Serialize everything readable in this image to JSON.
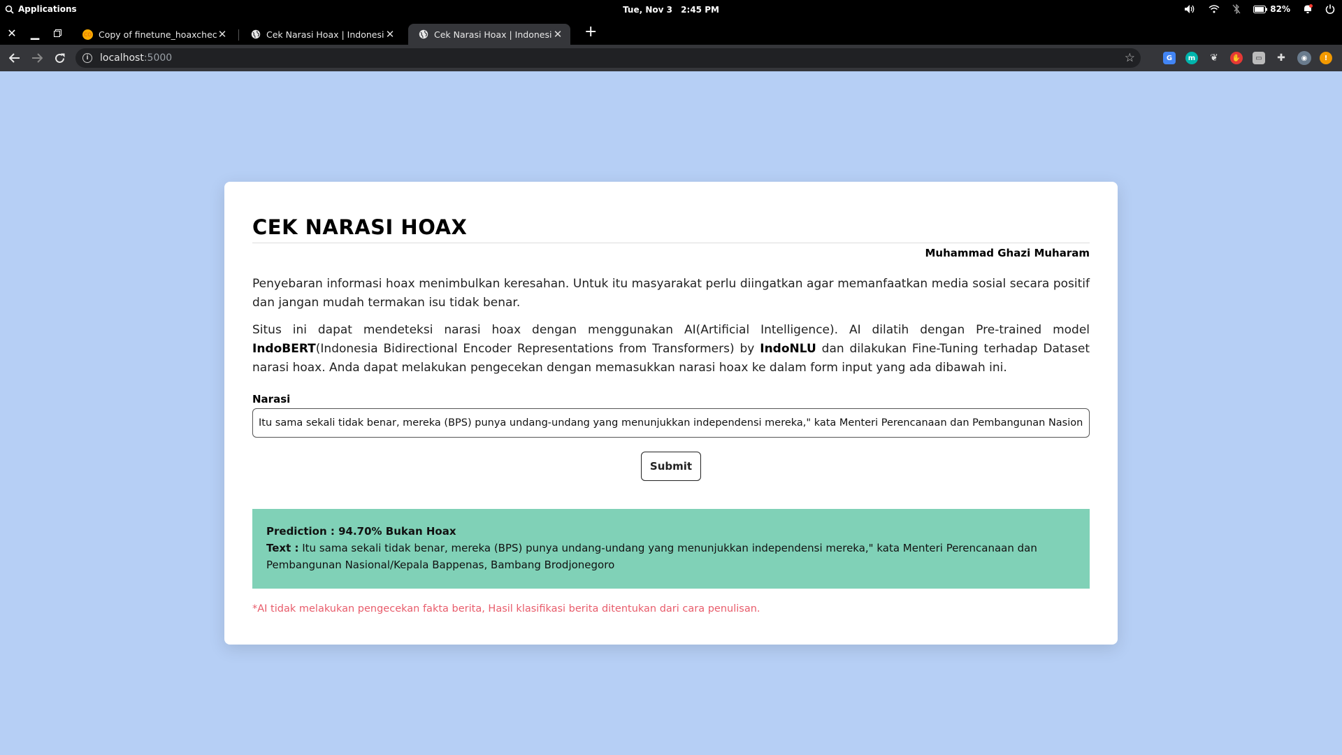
{
  "os": {
    "apps_label": "Applications",
    "date": "Tue, Nov 3",
    "time": "2:45 PM",
    "battery": "82%"
  },
  "tabs": [
    {
      "title": "Copy of finetune_hoaxchecker.ip",
      "favicon": "colab-icon",
      "active": false
    },
    {
      "title": "Cek Narasi Hoax | Indonesia",
      "favicon": "globe-icon",
      "active": false
    },
    {
      "title": "Cek Narasi Hoax | Indonesia",
      "favicon": "globe-icon",
      "active": true
    }
  ],
  "address": {
    "host": "localhost",
    "port": ":5000"
  },
  "page": {
    "title": "CEK NARASI HOAX",
    "author": "Muhammad Ghazi Muharam",
    "paragraph1": "Penyebaran informasi hoax menimbulkan keresahan. Untuk itu masyarakat perlu diingatkan agar memanfaatkan media sosial secara positif dan jangan mudah termakan isu tidak benar.",
    "paragraph2": {
      "part1": "Situs ini dapat mendeteksi narasi hoax dengan menggunakan AI(Artificial Intelligence). AI dilatih dengan Pre-trained model ",
      "bold1": "IndoBERT",
      "part2": "(Indonesia Bidirectional Encoder Representations from Transformers) by ",
      "bold2": "IndoNLU",
      "part3": " dan dilakukan Fine-Tuning terhadap Dataset narasi hoax. Anda dapat melakukan pengecekan dengan memasukkan narasi hoax ke dalam form input yang ada dibawah ini."
    },
    "field_label": "Narasi",
    "input_value": "Itu sama sekali tidak benar, mereka (BPS) punya undang-undang yang menunjukkan independensi mereka,\" kata Menteri Perencanaan dan Pembangunan Nasional/Kepala Bappenas, Bambang Brodjonegoro",
    "submit_label": "Submit",
    "result": {
      "prediction": "Prediction : 94.70% Bukan Hoax",
      "text_label": "Text :",
      "text_value": " Itu sama sekali tidak benar, mereka (BPS) punya undang-undang yang menunjukkan independensi mereka,\" kata Menteri Perencanaan dan Pembangunan Nasional/Kepala Bappenas, Bambang Brodjonegoro",
      "background": "#80d1b7"
    },
    "disclaimer": "*AI tidak melakukan pengecekan fakta berita, Hasil klasifikasi berita ditentukan dari cara penulisan."
  },
  "colors": {
    "page_bg": "#b6cff5",
    "disclaimer": "#e85c6b"
  }
}
